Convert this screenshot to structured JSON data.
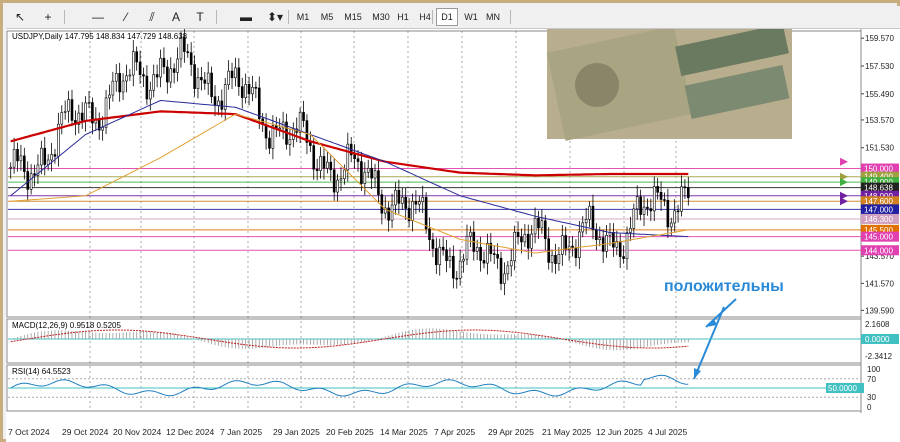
{
  "toolbar": {
    "tools": [
      {
        "name": "cursor-tool-button",
        "icon": "cursor-icon",
        "glyph": "↖"
      },
      {
        "name": "crosshair-tool-button",
        "icon": "crosshair-icon",
        "glyph": "+"
      },
      {
        "name": "horizontal-line-tool-button",
        "icon": "horizontal-line-icon",
        "glyph": "—"
      },
      {
        "name": "trendline-tool-button",
        "icon": "trendline-icon",
        "glyph": "⁄"
      },
      {
        "name": "channel-tool-button",
        "icon": "channel-icon",
        "glyph": "⫽"
      },
      {
        "name": "text-tool-button",
        "icon": "text-icon",
        "glyph": "A"
      },
      {
        "name": "text-label-tool-button",
        "icon": "text-label-icon",
        "glyph": "T"
      },
      {
        "name": "rectangle-tool-button",
        "icon": "rectangle-icon",
        "glyph": "▬"
      },
      {
        "name": "arrows-tool-button",
        "icon": "arrows-icon",
        "glyph": "⬍▾"
      }
    ],
    "timeframes": [
      "M1",
      "M5",
      "M15",
      "M30",
      "H1",
      "H4",
      "D1",
      "W1",
      "MN"
    ],
    "active_timeframe": "D1"
  },
  "chart": {
    "symbol_header": "USDJPY,Daily  147.795 148.834 147.729 148.638",
    "price_axis_ticks": [
      "159.570",
      "157.530",
      "155.490",
      "153.570",
      "151.530",
      "149.400",
      "147.600",
      "145.500",
      "143.570",
      "141.570",
      "139.590"
    ],
    "tick_values": [
      159.57,
      157.53,
      155.49,
      153.57,
      151.53,
      149.4,
      147.6,
      145.5,
      143.57,
      141.57,
      139.59
    ],
    "ylim": [
      139.1,
      160.1
    ],
    "date_labels": [
      "7 Oct 2024",
      "29 Oct 2024",
      "20 Nov 2024",
      "12 Dec 2024",
      "7 Jan 2025",
      "29 Jan 2025",
      "20 Feb 2025",
      "14 Mar 2025",
      "7 Apr 2025",
      "29 Apr 2025",
      "21 May 2025",
      "12 Jun 2025",
      "4 Jul 2025"
    ],
    "level_lines": [
      {
        "value": 150.0,
        "label": "150.000",
        "color": "#e040b0"
      },
      {
        "value": 149.4,
        "label": "149.400",
        "color": "#a0a040"
      },
      {
        "value": 149.0,
        "label": "149.000",
        "color": "#40b040"
      },
      {
        "value": 148.6,
        "label": "148.638",
        "color": "#222222"
      },
      {
        "value": 148.0,
        "label": "148.000",
        "color": "#7020a0"
      },
      {
        "value": 147.6,
        "label": "147.600",
        "color": "#d08020"
      },
      {
        "value": 147.0,
        "label": "147.000",
        "color": "#2020a0"
      },
      {
        "value": 146.3,
        "label": "146.300",
        "color": "#d0a0c0"
      },
      {
        "value": 145.5,
        "label": "145.500",
        "color": "#e07000"
      },
      {
        "value": 145.0,
        "label": "145.000",
        "color": "#e040b0"
      },
      {
        "value": 144.0,
        "label": "144.000",
        "color": "#e040b0"
      }
    ],
    "annotation_text": "положительны",
    "annotation_color": "#2a8ad8"
  },
  "chart_data": {
    "type": "line",
    "title": "USDJPY,Daily",
    "x": [
      "Oct 2024",
      "Nov 2024",
      "Dec 2024",
      "Jan 2025",
      "Feb 2025",
      "Mar 2025",
      "Apr 2025",
      "May 2025",
      "Jun 2025",
      "Jul 2025"
    ],
    "series": [
      {
        "name": "USDJPY",
        "values": [
          149.0,
          154.2,
          157.8,
          155.8,
          151.2,
          148.5,
          143.0,
          144.6,
          144.9,
          148.6
        ]
      },
      {
        "values": [
          152.0,
          153.5,
          154.2,
          154.0,
          152.0,
          150.5,
          149.7,
          149.5,
          149.6,
          149.6
        ]
      },
      {
        "values": [
          148.0,
          152.5,
          155.0,
          154.5,
          152.5,
          150.5,
          148.0,
          146.5,
          145.3,
          145.0
        ]
      },
      {
        "values": [
          147.6,
          148.0,
          150.8,
          154.0,
          152.5,
          147.0,
          144.8,
          143.8,
          144.5,
          145.5
        ]
      }
    ],
    "ylim": [
      139.59,
      159.57
    ],
    "macd": {
      "label": "MACD(12,26,9) 0.9518 0.5205",
      "ticks": [
        "2.1608",
        "0.0000",
        "-2.3412"
      ]
    },
    "rsi": {
      "label": "RSI(14) 64.5523",
      "ticks": [
        "100",
        "70",
        "50",
        "30",
        "0"
      ],
      "level_label": "50.0000",
      "last": 64.55
    }
  }
}
